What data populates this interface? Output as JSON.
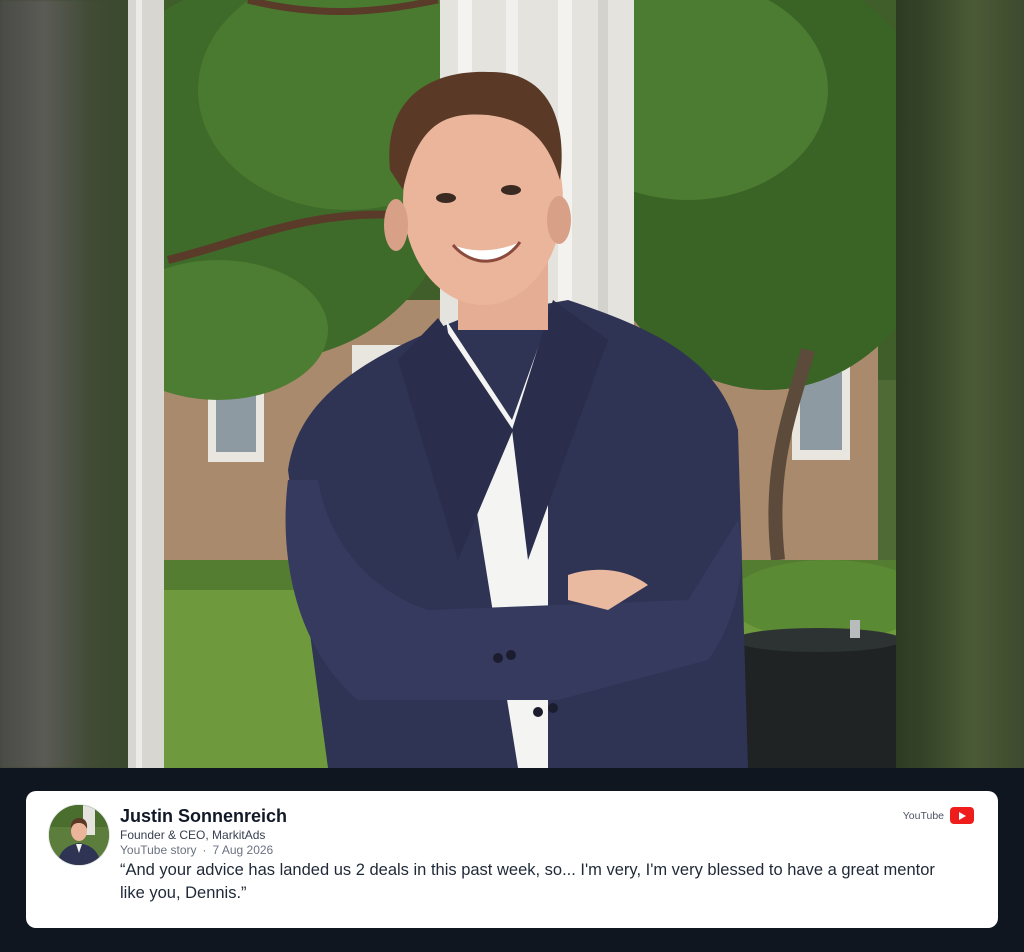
{
  "testimonial": {
    "name": "Justin Sonnenreich",
    "role": "Founder & CEO, MarkitAds",
    "source_type": "YouTube story",
    "date": "7 Aug 2026",
    "quote": "“And your advice has landed us 2 deals in this past week, so... I'm very, I'm very blessed to have a great mentor like you, Dennis.”",
    "platform_label": "YouTube",
    "platform_icon": "youtube-icon"
  },
  "photo": {
    "subject_icon": "portrait-photo"
  },
  "colors": {
    "page_background": "#0f1620",
    "card_background": "#ffffff",
    "youtube_red": "#ef1c1c",
    "jacket_navy": "#2f3354"
  }
}
